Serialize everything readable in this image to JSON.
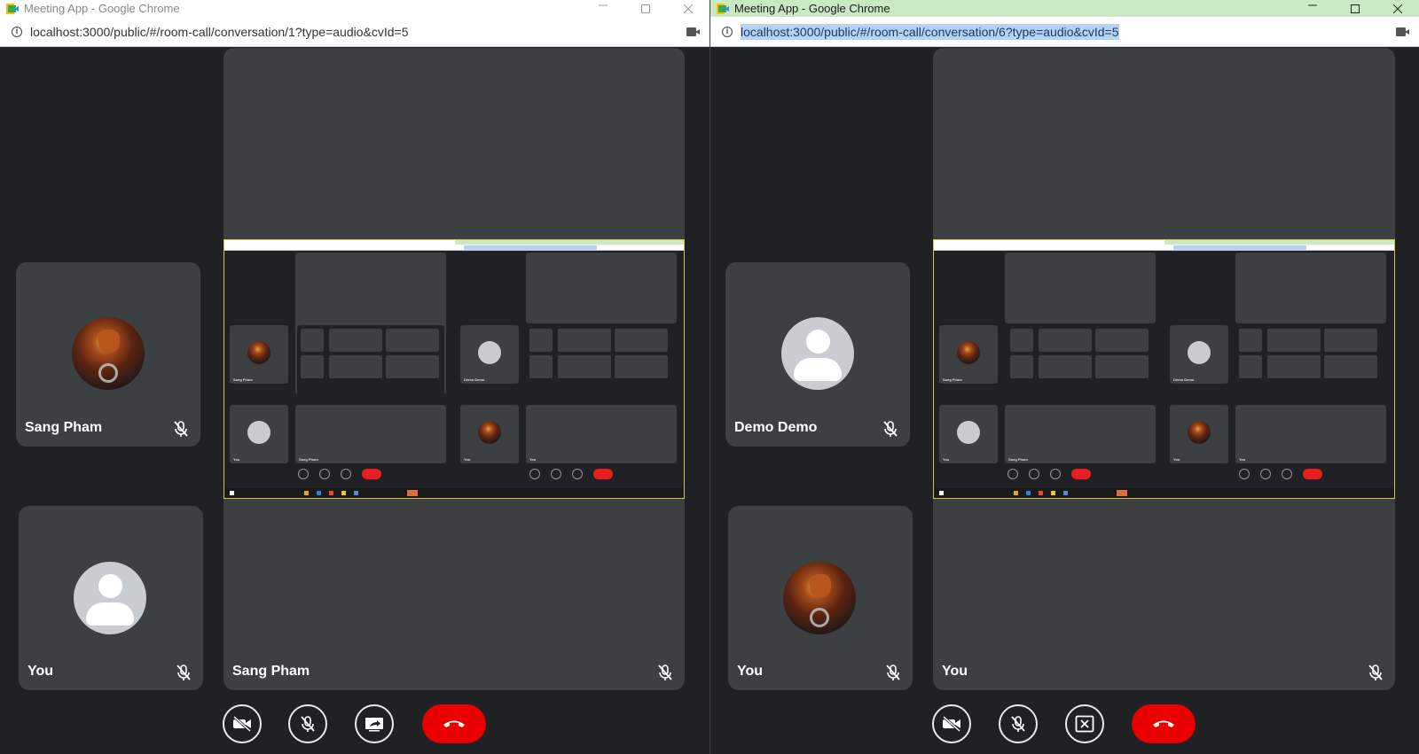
{
  "left_window": {
    "title": "Meeting App - Google Chrome",
    "url": "localhost:3000/public/#/room-call/conversation/1?type=audio&cvId=5",
    "window_controls": [
      "minimize",
      "maximize",
      "close"
    ],
    "participants": [
      {
        "name": "Sang Pham",
        "avatar": "photo",
        "muted": true
      },
      {
        "name": "You",
        "avatar": "default",
        "muted": true
      }
    ],
    "main_tile": {
      "name": "Sang Pham",
      "muted": true
    },
    "controls": [
      "camera-off",
      "mic-off",
      "share-screen",
      "end-call"
    ]
  },
  "right_window": {
    "title": "Meeting App - Google Chrome",
    "url": "localhost:3000/public/#/room-call/conversation/6?type=audio&cvId=5",
    "window_controls": [
      "minimize",
      "maximize",
      "close"
    ],
    "participants": [
      {
        "name": "Demo Demo",
        "avatar": "default",
        "muted": true
      },
      {
        "name": "You",
        "avatar": "photo",
        "muted": true
      }
    ],
    "main_tile": {
      "name": "You",
      "muted": true
    },
    "controls": [
      "camera-off",
      "mic-off",
      "stop-share",
      "end-call"
    ]
  },
  "shared_screen_thumbnail": {
    "tile_labels": [
      "Sang Pham",
      "You",
      "Sang Pham",
      "Demo Demo",
      "You",
      "You"
    ]
  },
  "colors": {
    "background": "#202124",
    "tile": "#3c4043",
    "end_call": "#ea0000",
    "active_titlebar": "#cbe8c4",
    "url_highlight": "#b6d3f2"
  }
}
